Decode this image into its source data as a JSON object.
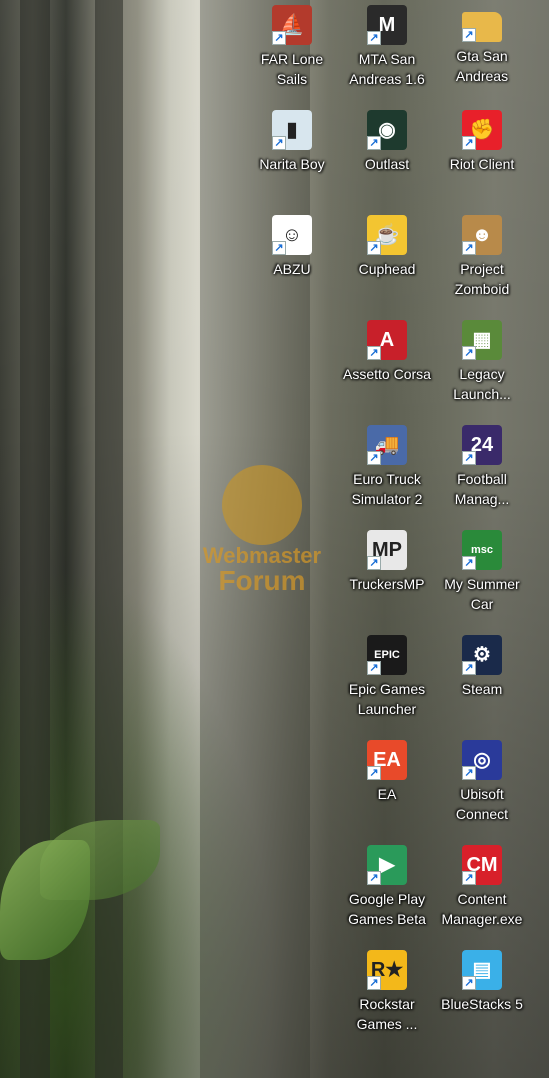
{
  "desktop_icons": [
    {
      "label": "FAR Lone Sails",
      "icon": "far-lone-sails-icon",
      "color": "#b33a2c"
    },
    {
      "label": "MTA San Andreas 1.6",
      "icon": "mta-icon",
      "color": "#2a2a2a"
    },
    {
      "label": "Gta San Andreas",
      "icon": "folder-icon",
      "color": "#e8b84a"
    },
    {
      "label": "Narita Boy",
      "icon": "narita-boy-icon",
      "color": "#d8e6ee"
    },
    {
      "label": "Outlast",
      "icon": "outlast-icon",
      "color": "#1e3a2e"
    },
    {
      "label": "Riot Client",
      "icon": "riot-client-icon",
      "color": "#e8202a"
    },
    {
      "label": "ABZU",
      "icon": "abzu-icon",
      "color": "#ffffff"
    },
    {
      "label": "Cuphead",
      "icon": "cuphead-icon",
      "color": "#f3c531"
    },
    {
      "label": "Project Zomboid",
      "icon": "project-zomboid-icon",
      "color": "#b88a4a"
    },
    {
      "label": "Assetto Corsa",
      "icon": "assetto-corsa-icon",
      "color": "#c8202a"
    },
    {
      "label": "Legacy Launch...",
      "icon": "minecraft-icon",
      "color": "#5a8a3a"
    },
    {
      "label": "Euro Truck Simulator 2",
      "icon": "euro-truck-icon",
      "color": "#4a6aa8"
    },
    {
      "label": "Football Manag...",
      "icon": "football-manager-icon",
      "color": "#3a2a6a"
    },
    {
      "label": "TruckersMP",
      "icon": "truckersmp-icon",
      "color": "#e8e8e8"
    },
    {
      "label": "My Summer Car",
      "icon": "my-summer-car-icon",
      "color": "#2a8a3a"
    },
    {
      "label": "Epic Games Launcher",
      "icon": "epic-games-icon",
      "color": "#1a1a1a"
    },
    {
      "label": "Steam",
      "icon": "steam-icon",
      "color": "#1a2a4a"
    },
    {
      "label": "EA",
      "icon": "ea-icon",
      "color": "#e84a2a"
    },
    {
      "label": "Ubisoft Connect",
      "icon": "ubisoft-icon",
      "color": "#2a3a9a"
    },
    {
      "label": "Google Play Games Beta",
      "icon": "google-play-games-icon",
      "color": "#2a9a5a"
    },
    {
      "label": "Content Manager.exe",
      "icon": "content-manager-icon",
      "color": "#d8202a"
    },
    {
      "label": "Rockstar Games ...",
      "icon": "rockstar-icon",
      "color": "#f3b81a"
    },
    {
      "label": "BlueStacks 5",
      "icon": "bluestacks-icon",
      "color": "#3ab0e8"
    }
  ],
  "glyphs": {
    "far-lone-sails-icon": "⛵",
    "mta-icon": "M",
    "folder-icon": "",
    "narita-boy-icon": "▮",
    "outlast-icon": "◉",
    "riot-client-icon": "✊",
    "abzu-icon": "☺",
    "cuphead-icon": "☕",
    "project-zomboid-icon": "☻",
    "assetto-corsa-icon": "A",
    "minecraft-icon": "▦",
    "euro-truck-icon": "🚚",
    "football-manager-icon": "24",
    "truckersmp-icon": "MP",
    "my-summer-car-icon": "msc",
    "epic-games-icon": "EPIC",
    "steam-icon": "⚙",
    "ea-icon": "EA",
    "ubisoft-icon": "◎",
    "google-play-games-icon": "▶",
    "content-manager-icon": "CM",
    "rockstar-icon": "R★",
    "bluestacks-icon": "▤"
  },
  "watermark": {
    "line1": "Webmaster",
    "line2": "Forum"
  }
}
